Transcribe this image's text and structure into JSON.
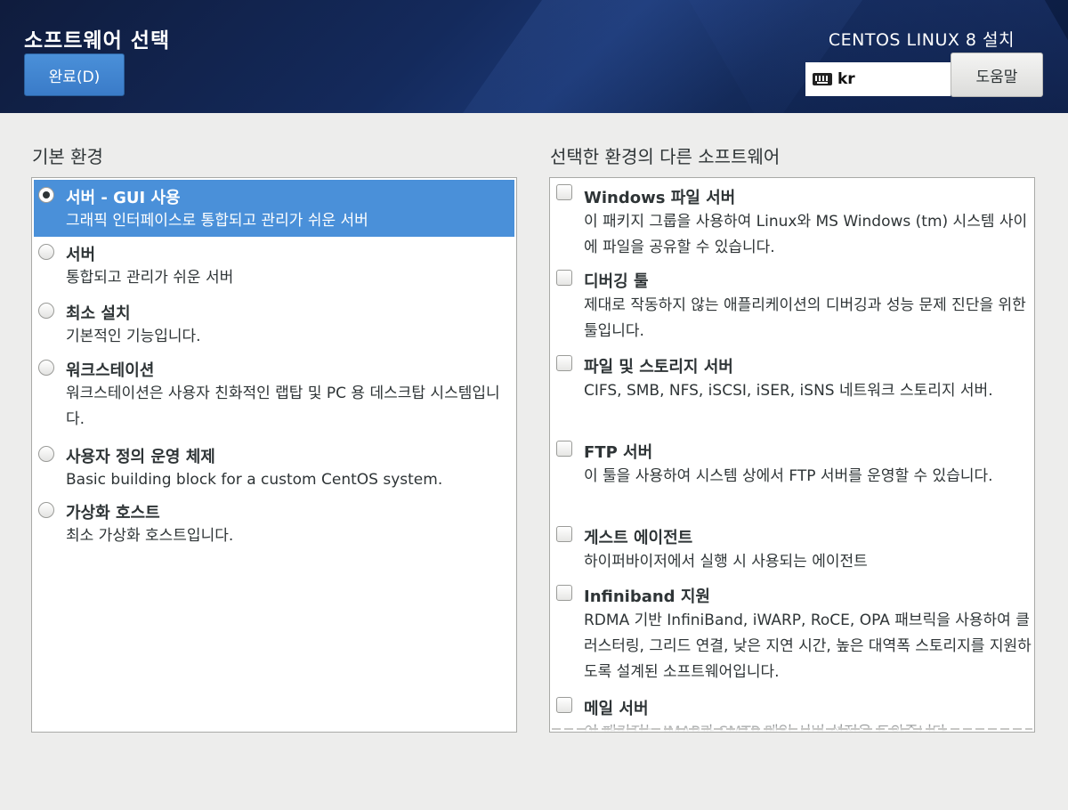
{
  "header": {
    "title": "소프트웨어 선택",
    "done_label": "완료(D)",
    "install_title": "CENTOS LINUX 8 설치",
    "keyboard_layout": "kr",
    "help_label": "도움말"
  },
  "base_env": {
    "title": "기본 환경",
    "items": [
      {
        "name": "서버 - GUI 사용",
        "desc": "그래픽 인터페이스로 통합되고 관리가 쉬운 서버",
        "selected": true
      },
      {
        "name": "서버",
        "desc": "통합되고 관리가 쉬운 서버",
        "selected": false
      },
      {
        "name": "최소 설치",
        "desc": "기본적인 기능입니다.",
        "selected": false
      },
      {
        "name": "워크스테이션",
        "desc": "워크스테이션은 사용자 친화적인 랩탑 및 PC 용 데스크탑 시스템입니다.",
        "selected": false
      },
      {
        "name": "사용자 정의 운영 체제",
        "desc": "Basic building block for a custom CentOS system.",
        "selected": false
      },
      {
        "name": "가상화 호스트",
        "desc": "최소 가상화 호스트입니다.",
        "selected": false
      }
    ]
  },
  "addons": {
    "title": "선택한 환경의 다른 소프트웨어",
    "items": [
      {
        "name": "Windows 파일 서버",
        "desc": "이 패키지 그룹을 사용하여 Linux와 MS Windows (tm) 시스템 사이에 파일을 공유할 수 있습니다.",
        "checked": false
      },
      {
        "name": "디버깅 툴",
        "desc": "제대로 작동하지 않는 애플리케이션의 디버깅과 성능 문제 진단을 위한 툴입니다.",
        "checked": false
      },
      {
        "name": "파일 및 스토리지 서버",
        "desc": "CIFS, SMB, NFS, iSCSI, iSER, iSNS 네트워크 스토리지 서버.",
        "checked": false
      },
      {
        "name": "FTP 서버",
        "desc": "이 툴을 사용하여 시스템 상에서 FTP 서버를 운영할 수 있습니다.",
        "checked": false
      },
      {
        "name": "게스트 에이전트",
        "desc": "하이퍼바이저에서 실행 시 사용되는 에이전트",
        "checked": false
      },
      {
        "name": "Infiniband 지원",
        "desc": "RDMA 기반 InfiniBand, iWARP, RoCE, OPA 패브릭을 사용하여 클러스터링, 그리드 연결, 낮은 지연 시간, 높은 대역폭 스토리지를 지원하도록 설계된 소프트웨어입니다.",
        "checked": false
      },
      {
        "name": "메일 서버",
        "desc": "이 패키지는 IMAP과 SMTP 메일 서버 설정을 도와줍니다.",
        "checked": false
      }
    ]
  }
}
